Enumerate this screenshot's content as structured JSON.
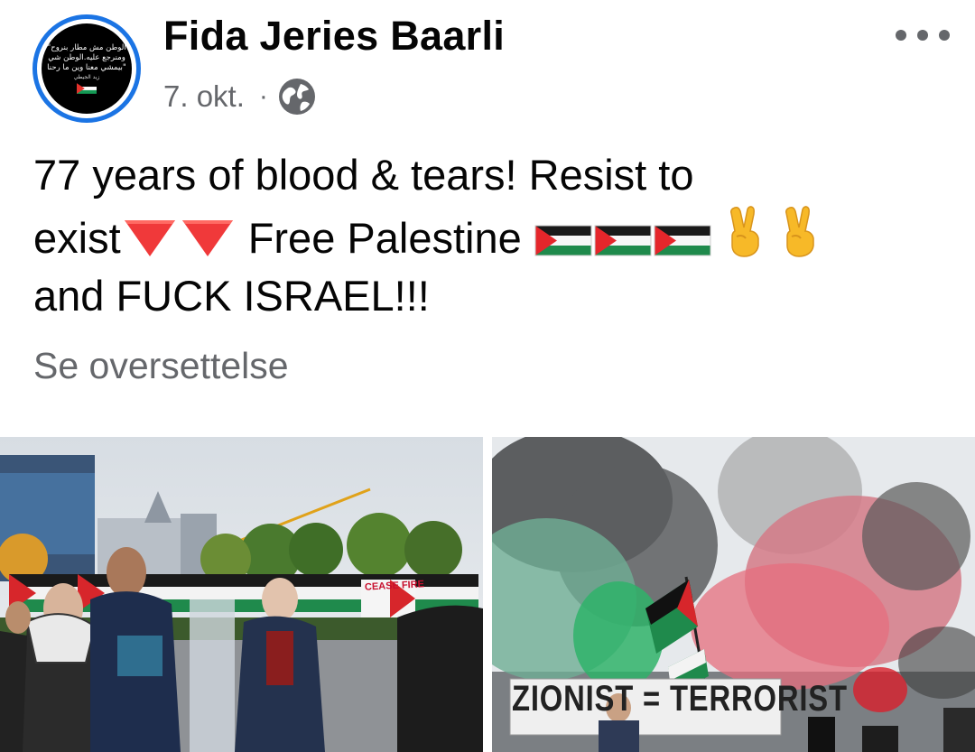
{
  "post": {
    "author": {
      "name": "Fida Jeries Baarli",
      "avatar_text": [
        "\"الوطن مش مطار بنروح",
        "ومنرجع عليه.الوطن شي",
        "بيمشي معنا وين ما رحنا\"",
        "زيد الجيطي"
      ]
    },
    "date": "7. okt.",
    "separator": "·",
    "privacy_icon": "globe-icon",
    "more_icon": "more-dots-icon",
    "text": {
      "line1": "77 years of blood & tears!  Resist to",
      "line2_start": "exist",
      "line2_mid": " Free Palestine ",
      "line3": "and FUCK ISRAEL!!!"
    },
    "emojis": [
      "red-triangle-icon",
      "red-triangle-icon",
      "palestine-flag-icon",
      "palestine-flag-icon",
      "palestine-flag-icon",
      "victory-hand-icon",
      "victory-hand-icon"
    ],
    "see_translation": "Se oversettelse",
    "photos": {
      "left": {
        "sign_text": "CEASE FIRE"
      },
      "right": {
        "sign_text": "ZIONIST = TERRORIST"
      }
    }
  },
  "colors": {
    "accent": "#1b74e4",
    "secondary_text": "#65676b",
    "primary_text": "#050505"
  }
}
